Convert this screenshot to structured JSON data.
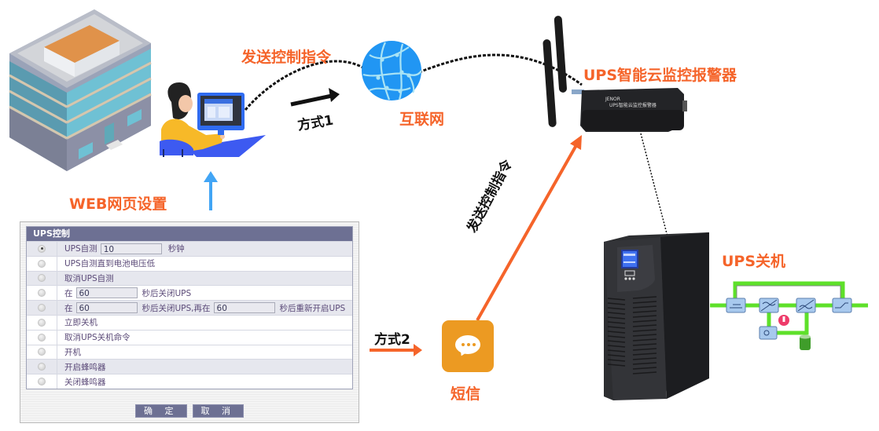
{
  "diagram": {
    "labels": {
      "send_command_top": "发送控制指令",
      "internet": "互联网",
      "method1": "方式1",
      "device_name": "UPS智能云监控报警器",
      "web_setup": "WEB网页设置",
      "method2": "方式2",
      "sms": "短信",
      "send_command_diagonal": "发送控制指令",
      "ups_shutdown": "UPS关机"
    },
    "device_printed": {
      "brand": "JENOR",
      "model_text": "UPS智能云监控报警器"
    },
    "colors": {
      "accent_orange": "#f5642a",
      "internet_blue": "#2196f3",
      "web_arrow_blue": "#42a5f5",
      "sms_orange": "#ec9a22",
      "panel_header": "#6d7093",
      "flow_green": "#5ee02a"
    },
    "icons": [
      "office-building-icon",
      "user-at-computer-icon",
      "globe-network-icon",
      "router-device-icon",
      "sms-chat-icon",
      "ups-tower-icon",
      "ups-flow-diagram-icon"
    ]
  },
  "form": {
    "title": "UPS控制",
    "rows": [
      {
        "selected": true,
        "parts": [
          "UPS自测"
        ],
        "field1": "10",
        "after1": "秒钟"
      },
      {
        "selected": false,
        "parts": [
          "UPS自测直到电池电压低"
        ]
      },
      {
        "selected": false,
        "parts": [
          "取消UPS自测"
        ]
      },
      {
        "selected": false,
        "parts": [
          "在"
        ],
        "field1": "60",
        "after1": "秒后关闭UPS"
      },
      {
        "selected": false,
        "parts": [
          "在"
        ],
        "field1": "60",
        "after1": "秒后关闭UPS,再在",
        "field2": "60",
        "after2": "秒后重新开启UPS"
      },
      {
        "selected": false,
        "parts": [
          "立即关机"
        ]
      },
      {
        "selected": false,
        "parts": [
          "取消UPS关机命令"
        ]
      },
      {
        "selected": false,
        "parts": [
          "开机"
        ]
      },
      {
        "selected": false,
        "parts": [
          "开启蜂鸣器"
        ]
      },
      {
        "selected": false,
        "parts": [
          "关闭蜂鸣器"
        ]
      }
    ],
    "buttons": {
      "confirm": "确 定",
      "cancel": "取 消"
    }
  }
}
